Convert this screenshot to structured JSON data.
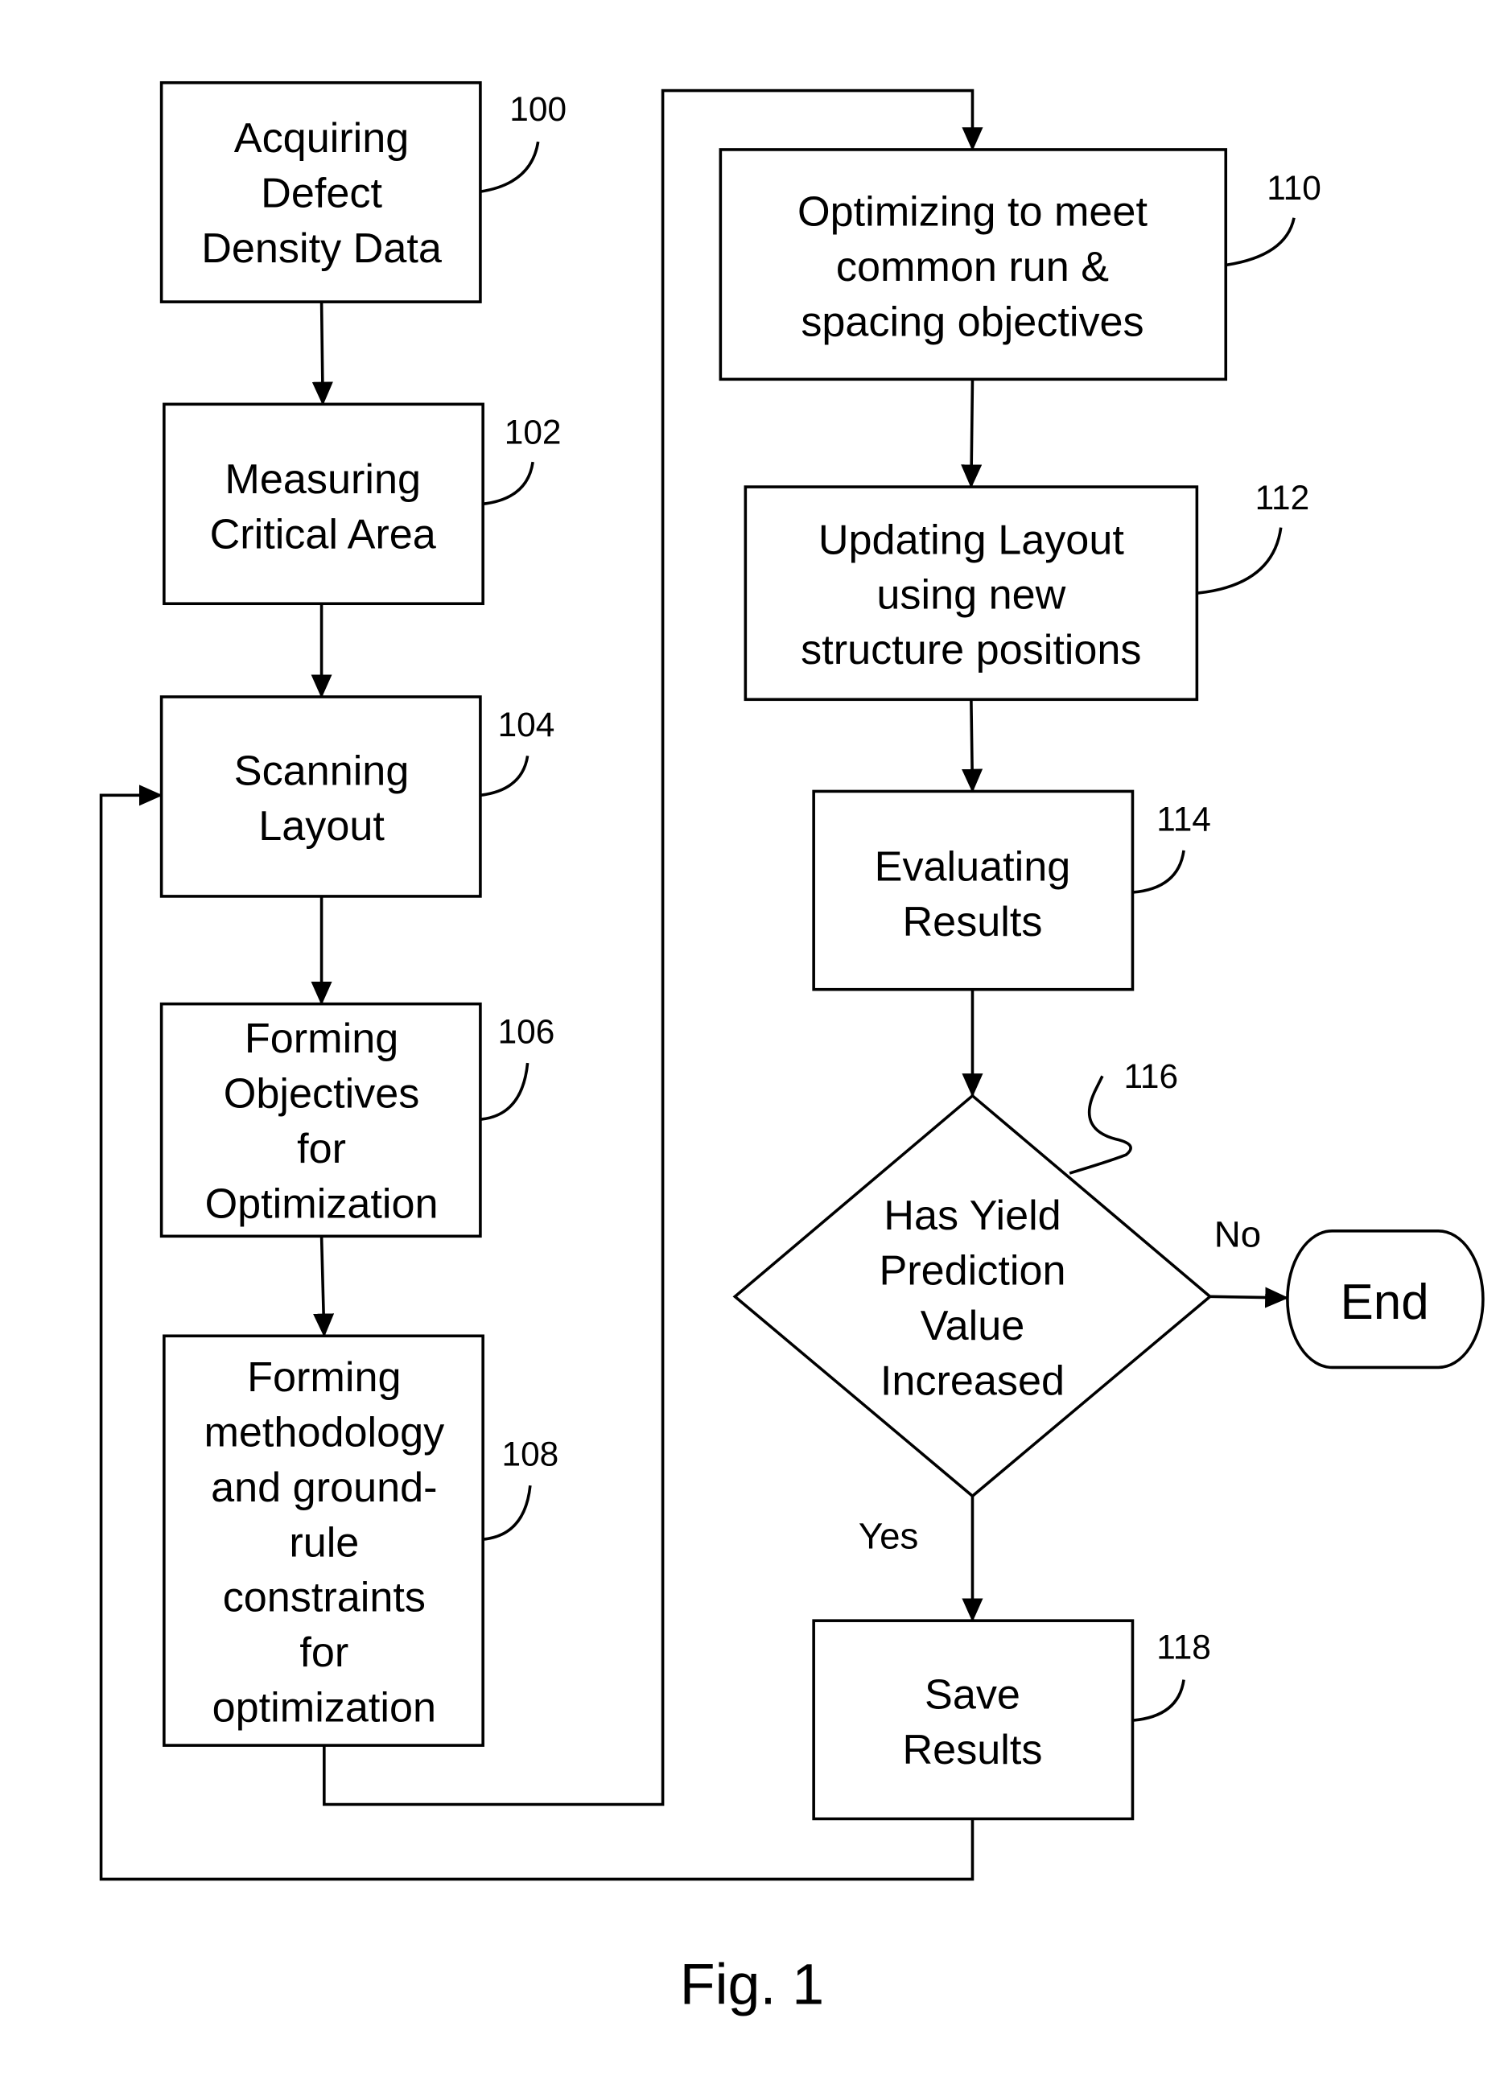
{
  "figure": {
    "caption": "Fig. 1"
  },
  "steps": {
    "s100": {
      "ref": "100",
      "lines": [
        "Acquiring",
        "Defect",
        "Density Data"
      ]
    },
    "s102": {
      "ref": "102",
      "lines": [
        "Measuring",
        "Critical Area"
      ]
    },
    "s104": {
      "ref": "104",
      "lines": [
        "Scanning",
        "Layout"
      ]
    },
    "s106": {
      "ref": "106",
      "lines": [
        "Forming",
        "Objectives",
        "for",
        "Optimization"
      ]
    },
    "s108": {
      "ref": "108",
      "lines": [
        "Forming",
        "methodology",
        "and ground-",
        "rule",
        "constraints",
        "for",
        "optimization"
      ]
    },
    "s110": {
      "ref": "110",
      "lines": [
        "Optimizing to meet",
        "common run &",
        "spacing objectives"
      ]
    },
    "s112": {
      "ref": "112",
      "lines": [
        "Updating Layout",
        "using new",
        "structure positions"
      ]
    },
    "s114": {
      "ref": "114",
      "lines": [
        "Evaluating",
        "Results"
      ]
    },
    "s116": {
      "ref": "116",
      "lines": [
        "Has Yield",
        "Prediction",
        "Value",
        "Increased"
      ]
    },
    "s118": {
      "ref": "118",
      "lines": [
        "Save",
        "Results"
      ]
    }
  },
  "terminal": {
    "label": "End"
  },
  "branches": {
    "no": "No",
    "yes": "Yes"
  }
}
